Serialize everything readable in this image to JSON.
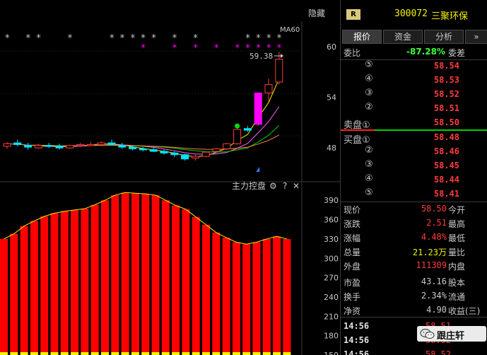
{
  "chart": {
    "ma_label": "MA60",
    "hide_label": "隐藏",
    "last_price_label": "59.38",
    "price_axis": [
      "60",
      "54",
      "48"
    ],
    "indicator_title": "主力控盘",
    "indicator_axis": [
      "390",
      "360",
      "330",
      "300",
      "270",
      "240",
      "210",
      "180",
      "150"
    ]
  },
  "chart_data": [
    {
      "type": "candlestick",
      "title": "",
      "ylim": [
        44,
        63
      ],
      "y_ticks": [
        60,
        54,
        48
      ],
      "candles": [
        {
          "o": 48.2,
          "h": 48.7,
          "l": 47.9,
          "c": 48.5
        },
        {
          "o": 48.6,
          "h": 49.0,
          "l": 48.2,
          "c": 48.4
        },
        {
          "o": 48.3,
          "h": 48.6,
          "l": 47.8,
          "c": 48.1
        },
        {
          "o": 48.0,
          "h": 48.5,
          "l": 47.9,
          "c": 48.3
        },
        {
          "o": 48.3,
          "h": 48.6,
          "l": 48.0,
          "c": 48.2
        },
        {
          "o": 48.2,
          "h": 48.5,
          "l": 47.8,
          "c": 48.0
        },
        {
          "o": 48.0,
          "h": 48.4,
          "l": 47.9,
          "c": 48.3
        },
        {
          "o": 48.3,
          "h": 48.6,
          "l": 48.1,
          "c": 48.4
        },
        {
          "o": 48.4,
          "h": 48.7,
          "l": 48.2,
          "c": 48.4
        },
        {
          "o": 48.4,
          "h": 48.8,
          "l": 48.2,
          "c": 48.6
        },
        {
          "o": 48.6,
          "h": 49.0,
          "l": 48.3,
          "c": 48.4
        },
        {
          "o": 48.3,
          "h": 48.6,
          "l": 47.9,
          "c": 48.1
        },
        {
          "o": 48.1,
          "h": 48.3,
          "l": 47.7,
          "c": 47.9
        },
        {
          "o": 47.9,
          "h": 48.1,
          "l": 47.6,
          "c": 47.8
        },
        {
          "o": 47.8,
          "h": 48.0,
          "l": 47.5,
          "c": 47.6
        },
        {
          "o": 47.6,
          "h": 47.8,
          "l": 47.2,
          "c": 47.4
        },
        {
          "o": 47.4,
          "h": 47.6,
          "l": 46.9,
          "c": 47.2
        },
        {
          "o": 47.2,
          "h": 47.3,
          "l": 46.5,
          "c": 46.7
        },
        {
          "o": 46.8,
          "h": 47.2,
          "l": 46.5,
          "c": 47.0
        },
        {
          "o": 47.0,
          "h": 47.6,
          "l": 46.9,
          "c": 47.5
        },
        {
          "o": 47.6,
          "h": 48.0,
          "l": 47.4,
          "c": 47.9
        },
        {
          "o": 47.9,
          "h": 48.6,
          "l": 47.8,
          "c": 48.5
        },
        {
          "o": 48.5,
          "h": 50.5,
          "l": 48.4,
          "c": 50.2
        },
        {
          "o": 50.3,
          "h": 50.6,
          "l": 49.9,
          "c": 50.1
        },
        {
          "o": 50.8,
          "h": 54.5,
          "l": 50.6,
          "c": 54.5
        },
        {
          "o": 54.5,
          "h": 56.2,
          "l": 53.5,
          "c": 55.5
        },
        {
          "o": 55.8,
          "h": 59.38,
          "l": 55.5,
          "c": 58.5
        }
      ]
    },
    {
      "type": "bar",
      "title": "主力控盘",
      "ylim": [
        150,
        410
      ],
      "y_ticks": [
        390,
        360,
        330,
        300,
        270,
        240,
        210,
        180,
        150
      ],
      "values": [
        330,
        338,
        350,
        358,
        365,
        370,
        373,
        375,
        377,
        383,
        390,
        398,
        402,
        401,
        400,
        398,
        390,
        382,
        376,
        364,
        352,
        340,
        332,
        325,
        322,
        325,
        330,
        334,
        330
      ]
    }
  ],
  "header": {
    "badge": "R",
    "code": "300072",
    "name": "三聚环保"
  },
  "tabs": [
    {
      "label": "报价"
    },
    {
      "label": "资金"
    },
    {
      "label": "分析"
    },
    {
      "label": "»"
    }
  ],
  "commission": {
    "label": "委比",
    "value": "-87.28%",
    "diff_label": "委差"
  },
  "sell_book": [
    {
      "level": "⑤",
      "price": "58.54"
    },
    {
      "level": "④",
      "price": "58.53"
    },
    {
      "level": "③",
      "price": "58.52"
    },
    {
      "level": "②",
      "price": "58.51"
    },
    {
      "level": "卖盘①",
      "price": "58.50"
    }
  ],
  "buy_book": [
    {
      "level": "买盘①",
      "price": "58.48"
    },
    {
      "level": "②",
      "price": "58.46"
    },
    {
      "level": "③",
      "price": "58.45"
    },
    {
      "level": "④",
      "price": "58.44"
    },
    {
      "level": "⑤",
      "price": "58.41"
    }
  ],
  "stats": [
    {
      "label": "现价",
      "value": "58.50",
      "label2": "今开",
      "color": "#ff3b3b"
    },
    {
      "label": "涨跌",
      "value": "2.51",
      "label2": "最高",
      "color": "#ff3b3b"
    },
    {
      "label": "涨幅",
      "value": "4.48%",
      "label2": "最低",
      "color": "#ff3b3b"
    },
    {
      "label": "总量",
      "value": "21.23万",
      "label2": "量比",
      "color": "#f2f200"
    },
    {
      "label": "外盘",
      "value": "111309",
      "label2": "内盘",
      "color": "#ff3b3b"
    },
    {
      "label": "市盈",
      "value": "43.16",
      "label2": "股本",
      "color": "#c8c8c8"
    },
    {
      "label": "换手",
      "value": "2.34%",
      "label2": "流通",
      "color": "#c8c8c8"
    },
    {
      "label": "净资",
      "value": "4.90",
      "label2": "收益(三)",
      "color": "#c8c8c8"
    }
  ],
  "ticks": [
    {
      "time": "14:56",
      "price": "58.51"
    },
    {
      "time": "14:56",
      "price": "58.52"
    },
    {
      "time": "14:56",
      "price": "58.52"
    }
  ],
  "watermark": {
    "text": "跟庄轩"
  },
  "colors": {
    "up": "#ff3b3b",
    "down": "#00e5ff",
    "magenta": "#ff00ff",
    "bar_fill": "#ff0000",
    "bar_line": "#f2f200"
  }
}
